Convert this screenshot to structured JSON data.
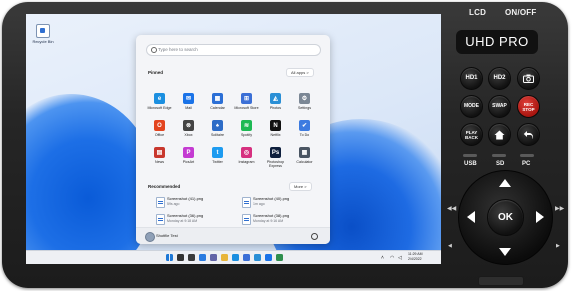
{
  "device": {
    "lcd_label": "LCD",
    "onoff_label": "ON/OFF",
    "model_badge": "UHD PRO",
    "buttons": {
      "hd1": "HD1",
      "hd2": "HD2",
      "mode": "MODE",
      "swap": "SWAP",
      "rec_stop": "REC\nSTOP",
      "playback": "PLAY\nBACK",
      "ok": "OK"
    },
    "port_labels": [
      "USB",
      "SD",
      "PC"
    ],
    "colors": {
      "rec_stop": "#c0201c",
      "body": "#262626"
    }
  },
  "desktop": {
    "icon_label": "Recycle Bin"
  },
  "start_menu": {
    "search_placeholder": "Type here to search",
    "pinned_title": "Pinned",
    "all_apps_label": "All apps  >",
    "pinned_apps": [
      {
        "label": "Microsoft Edge",
        "icon": "edge-icon",
        "color": "#1b8fe0",
        "glyph": "e"
      },
      {
        "label": "Mail",
        "icon": "mail-icon",
        "color": "#1a73e8",
        "glyph": "✉"
      },
      {
        "label": "Calendar",
        "icon": "calendar-icon",
        "color": "#2b6fd6",
        "glyph": "▦"
      },
      {
        "label": "Microsoft Store",
        "icon": "store-icon",
        "color": "#3b6fd6",
        "glyph": "⊞"
      },
      {
        "label": "Photos",
        "icon": "photos-icon",
        "color": "#2a8fd6",
        "glyph": "◭"
      },
      {
        "label": "Settings",
        "icon": "gear-icon",
        "color": "#7b8795",
        "glyph": "⚙"
      },
      {
        "label": "Office",
        "icon": "office-icon",
        "color": "#e3441f",
        "glyph": "O"
      },
      {
        "label": "Xbox",
        "icon": "xbox-icon",
        "color": "#444444",
        "glyph": "⊗"
      },
      {
        "label": "Solitaire",
        "icon": "solitaire-icon",
        "color": "#2d6cc7",
        "glyph": "♠"
      },
      {
        "label": "Spotify",
        "icon": "spotify-icon",
        "color": "#1db954",
        "glyph": "≋"
      },
      {
        "label": "Netflix",
        "icon": "netflix-icon",
        "color": "#111111",
        "glyph": "N"
      },
      {
        "label": "To Do",
        "icon": "todo-icon",
        "color": "#3d7be0",
        "glyph": "✔"
      },
      {
        "label": "News",
        "icon": "news-icon",
        "color": "#c8372d",
        "glyph": "▤"
      },
      {
        "label": "PicsArt",
        "icon": "picsart-icon",
        "color": "#c43bd2",
        "glyph": "P"
      },
      {
        "label": "Twitter",
        "icon": "twitter-icon",
        "color": "#1d9bf0",
        "glyph": "t"
      },
      {
        "label": "Instagram",
        "icon": "instagram-icon",
        "color": "#d6307f",
        "glyph": "◎"
      },
      {
        "label": "Photoshop Express",
        "icon": "photoshop-icon",
        "color": "#0e1f3d",
        "glyph": "Ps"
      },
      {
        "label": "Calculator",
        "icon": "calculator-icon",
        "color": "#4a5563",
        "glyph": "▦"
      }
    ],
    "recommended_title": "Recommended",
    "more_label": "More  >",
    "recommended": [
      {
        "name": "Screenshot (41).png",
        "time": "59s ago"
      },
      {
        "name": "Screenshot (40).png",
        "time": "1m ago"
      },
      {
        "name": "Screenshot (36).png",
        "time": "Monday at 9:18 AM"
      },
      {
        "name": "Screenshot (38).png",
        "time": "Monday at 9:16 AM"
      }
    ],
    "user_name": "Shotfile Test"
  },
  "taskbar": {
    "apps": [
      {
        "icon": "start-icon",
        "color": "#1e78d6"
      },
      {
        "icon": "search-icon",
        "color": "#333333"
      },
      {
        "icon": "task-view-icon",
        "color": "#3b3b3b"
      },
      {
        "icon": "widgets-icon",
        "color": "#2a7be0"
      },
      {
        "icon": "chat-icon",
        "color": "#6264a7"
      },
      {
        "icon": "file-explorer-icon",
        "color": "#e8b53a"
      },
      {
        "icon": "edge-icon",
        "color": "#1b8fe0"
      },
      {
        "icon": "store-icon",
        "color": "#3b6fd6"
      },
      {
        "icon": "photos-icon",
        "color": "#2a8fd6"
      },
      {
        "icon": "mail-icon",
        "color": "#1a73e8"
      },
      {
        "icon": "app-icon",
        "color": "#2f8f4e"
      }
    ],
    "time": "11:29 AM",
    "date": "2/4/2022"
  }
}
